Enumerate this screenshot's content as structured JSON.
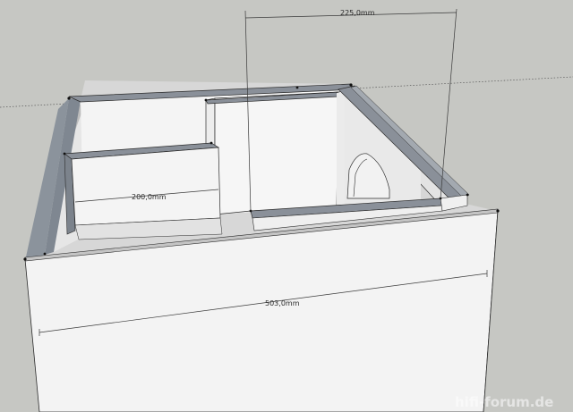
{
  "model": {
    "dimensions": {
      "top_width": "225,0mm",
      "shelf_width": "200,0mm",
      "front_width": "503,0mm"
    }
  },
  "watermark": {
    "text": "hifi-forum.de"
  },
  "colors": {
    "background": "#c6c7c3",
    "panel_face": "#f3f3f3",
    "panel_edge": "#8a9099",
    "inner_wall": "#dcdcdc",
    "shadow": "#a9a9a9",
    "dimension_line": "#3a3a3a"
  }
}
